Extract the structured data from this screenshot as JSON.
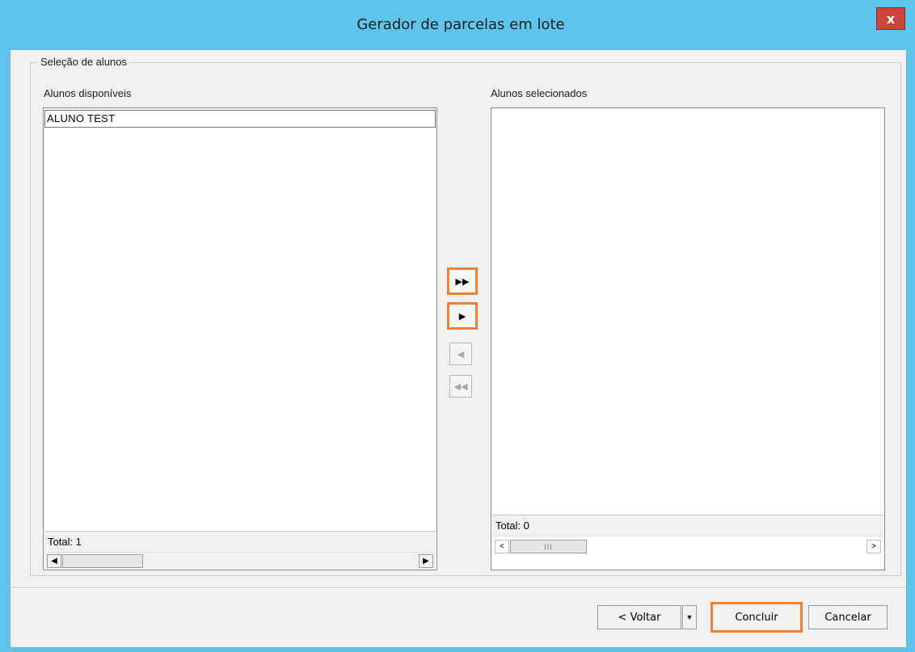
{
  "window": {
    "title": "Gerador de parcelas em lote",
    "close_label": "x"
  },
  "group": {
    "legend": "Seleção de alunos"
  },
  "available": {
    "label": "Alunos disponíveis",
    "items": [
      "ALUNO TEST"
    ],
    "total": "Total: 1"
  },
  "selected": {
    "label": "Alunos selecionados",
    "items": [],
    "total": "Total: 0"
  },
  "move_buttons": {
    "move_all_right": "▶▶",
    "move_right": "▶",
    "move_left": "◀",
    "move_all_left": "◀◀"
  },
  "footer": {
    "back_label": "< Voltar",
    "back_dropdown": "▼",
    "finish_label": "Concluir",
    "cancel_label": "Cancelar"
  },
  "scroll": {
    "left_arrow": "◀",
    "right_arrow": "▶",
    "left_arrow_alt": "<",
    "right_arrow_alt": ">",
    "thumb_grip": "III"
  },
  "colors": {
    "titlebar": "#5fc4ec",
    "close": "#c7463d",
    "highlight": "#ef8136",
    "dialog_bg": "#f0f0f0"
  }
}
